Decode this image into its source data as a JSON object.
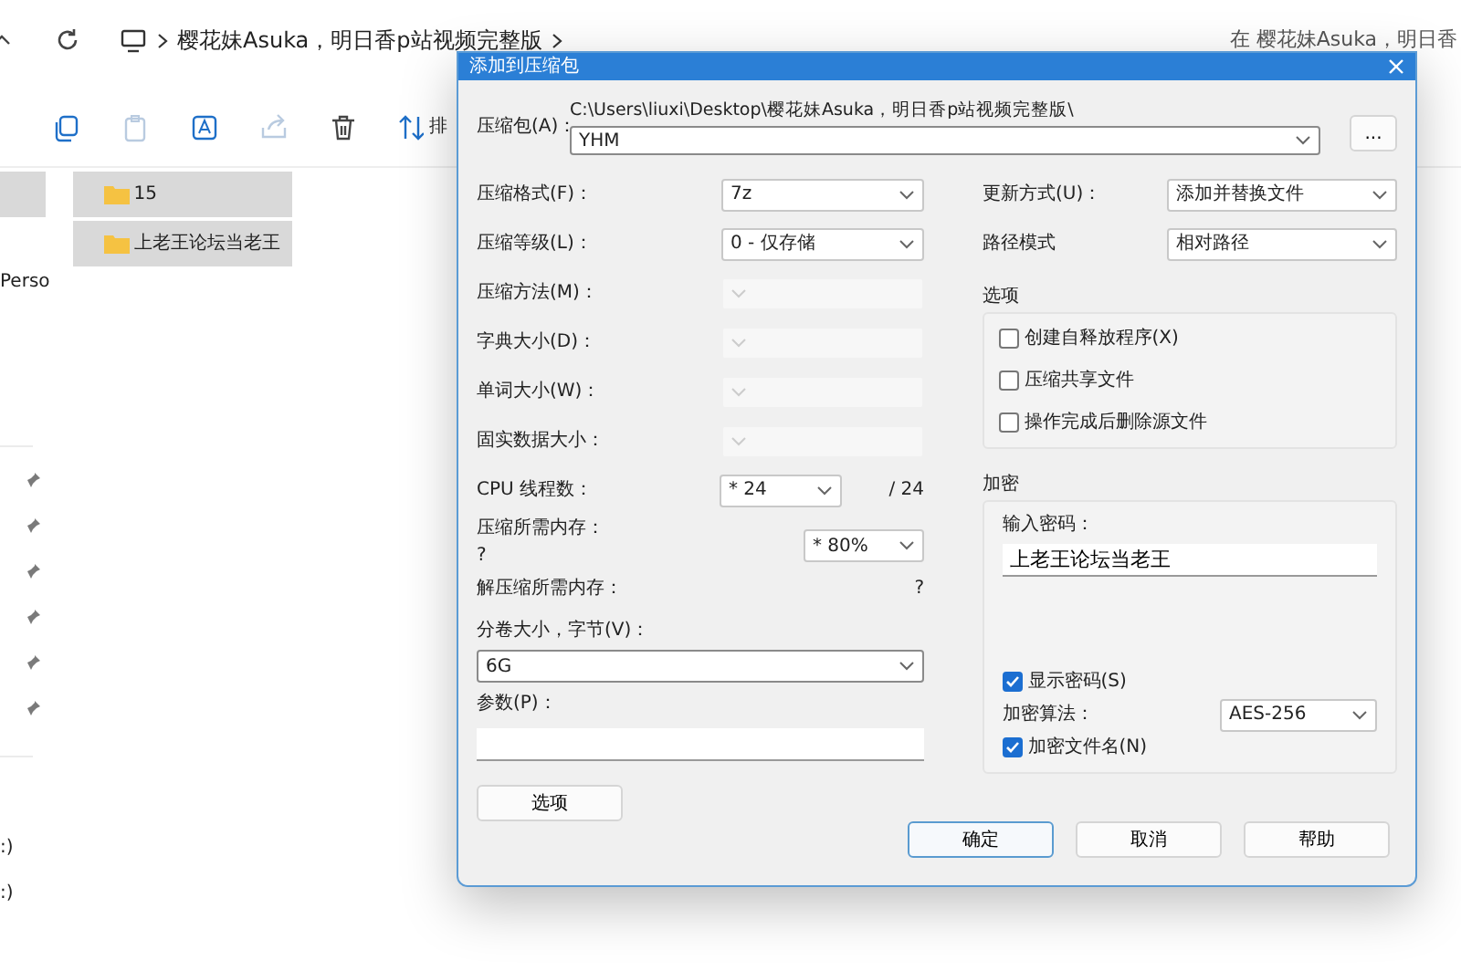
{
  "explorer": {
    "address": {
      "breadcrumb": "樱花妹Asuka，明日香p站视频完整版",
      "search_text": "在 樱花妹Asuka，明日香"
    },
    "toolbar": {
      "sort_label": "排"
    },
    "sidebar": {
      "nav_item": {
        "selected": true
      },
      "top_label": "Perso",
      "drives": [
        ":)",
        ":)"
      ]
    },
    "files": [
      {
        "name": "15",
        "selected": true
      },
      {
        "name": "上老王论坛当老王",
        "selected": true
      }
    ]
  },
  "dialog": {
    "title": "添加到压缩包",
    "archive": {
      "label": "压缩包(A)：",
      "path": "C:\\Users\\liuxi\\Desktop\\樱花妹Asuka，明日香p站视频完整版\\",
      "name": "YHM",
      "browse_button": "..."
    },
    "left_rows": [
      {
        "kind": "select",
        "label": "压缩格式(F)：",
        "value": "7z",
        "disabled": false
      },
      {
        "kind": "select",
        "label": "压缩等级(L)：",
        "value": "0 - 仅存储",
        "disabled": false
      },
      {
        "kind": "select",
        "label": "压缩方法(M)：",
        "disabled": true
      },
      {
        "kind": "select",
        "label": "字典大小(D)：",
        "disabled": true
      },
      {
        "kind": "select",
        "label": "单词大小(W)：",
        "disabled": true
      },
      {
        "kind": "select",
        "label": "固实数据大小：",
        "disabled": true
      },
      {
        "kind": "threads",
        "label": "CPU 线程数：",
        "value": "* 24",
        "suffix": "/ 24"
      },
      {
        "kind": "memory",
        "label": "压缩所需内存：",
        "note": "?",
        "value": "* 80%"
      },
      {
        "kind": "info",
        "label": "解压缩所需内存：",
        "note": "?"
      },
      {
        "kind": "combo",
        "label": "分卷大小，字节(V)：",
        "value": "6G"
      },
      {
        "kind": "input",
        "label": "参数(P)："
      }
    ],
    "update_mode": {
      "label": "更新方式(U)：",
      "value": "添加并替换文件"
    },
    "path_mode": {
      "label": "路径模式",
      "value": "相对路径"
    },
    "options": {
      "title": "选项",
      "items": [
        {
          "label": "创建自释放程序(X)",
          "checked": false
        },
        {
          "label": "压缩共享文件",
          "checked": false
        },
        {
          "label": "操作完成后删除源文件",
          "checked": false
        }
      ]
    },
    "encryption": {
      "title": "加密",
      "password_label": "输入密码：",
      "password": "上老王论坛当老王",
      "show_password": {
        "label": "显示密码(S)",
        "checked": true
      },
      "method_label": "加密算法：",
      "method": "AES-256",
      "encrypt_names": {
        "label": "加密文件名(N)",
        "checked": true
      }
    },
    "options_button": "选项",
    "buttons": [
      {
        "label": "确定",
        "default": true
      },
      {
        "label": "取消",
        "default": false
      },
      {
        "label": "帮助",
        "default": false
      }
    ]
  }
}
